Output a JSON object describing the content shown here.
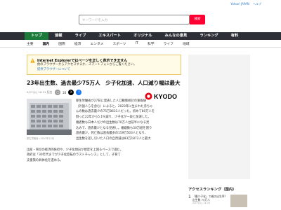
{
  "toplinks": [
    "Yahoo! JAPAN",
    "ヘルプ"
  ],
  "search": {
    "placeholder": "キーワードを入力",
    "button": "検索"
  },
  "nav": [
    "トップ",
    "速報",
    "ライブ",
    "エキスパート",
    "オリジナル",
    "みんなの意見",
    "ランキング",
    "有料"
  ],
  "subnav": [
    "主要",
    "国内",
    "国際",
    "経済",
    "エンタメ",
    "スポーツ",
    "IT",
    "科学",
    "ライフ",
    "地域"
  ],
  "notice": {
    "title": "Internet Explorerではページを正しく表示できません",
    "body": "他のブラウザーからアクセスするか、スマートフォンからご覧ください。",
    "link": "提供ブラウザーについて"
  },
  "article": {
    "title": "23年出生数、過去最少75万人　少子化加速、人口減り幅は最大",
    "date": "2/27(火) 16:31 配信",
    "comment_count": "20",
    "source": "KYODO",
    "photo_caption": "厚生労働省＝2023年12月",
    "body": [
      "厚生労働省が27日に発表した人口動態統計の速報値",
      "（外国人らを含む）によると、2023年に生まれた赤ちゃ",
      "んの数は過去最少の75万8631人だった。初めて80万人を",
      "割った22年から5.1％減り、少子化が一段と加速した。",
      "婚者数も日本人だけの出生数は70万人台前半になる見",
      "込みで、過去最少となる見通し。婚姻数も50万組を割り",
      "過去最少。死亡数は過去最多の159万503人となり、",
      "出生数を差し引いた人口の自然減は83万1872人と最大"
    ],
    "lead": [
      "出産・育児の経済的負担や、少子化傾向が想定を上回るペースで進む。",
      "政府は「30年代までが少子化反転のラストチャンス」として、子育て",
      "支援策の具体化を進める。"
    ]
  },
  "ranking": {
    "title": "アクセスランキング（国内）",
    "items": [
      {
        "num": "1",
        "text": "「最少子化」で親の出生率？ 出生数 75万人",
        "date": "2/27(火) 11:22"
      }
    ]
  },
  "colors": {
    "nav_bg": "#2d3137",
    "nav_active": "#1c7a3a",
    "search_btn": "#ff0033",
    "link": "#2c7bd0"
  }
}
